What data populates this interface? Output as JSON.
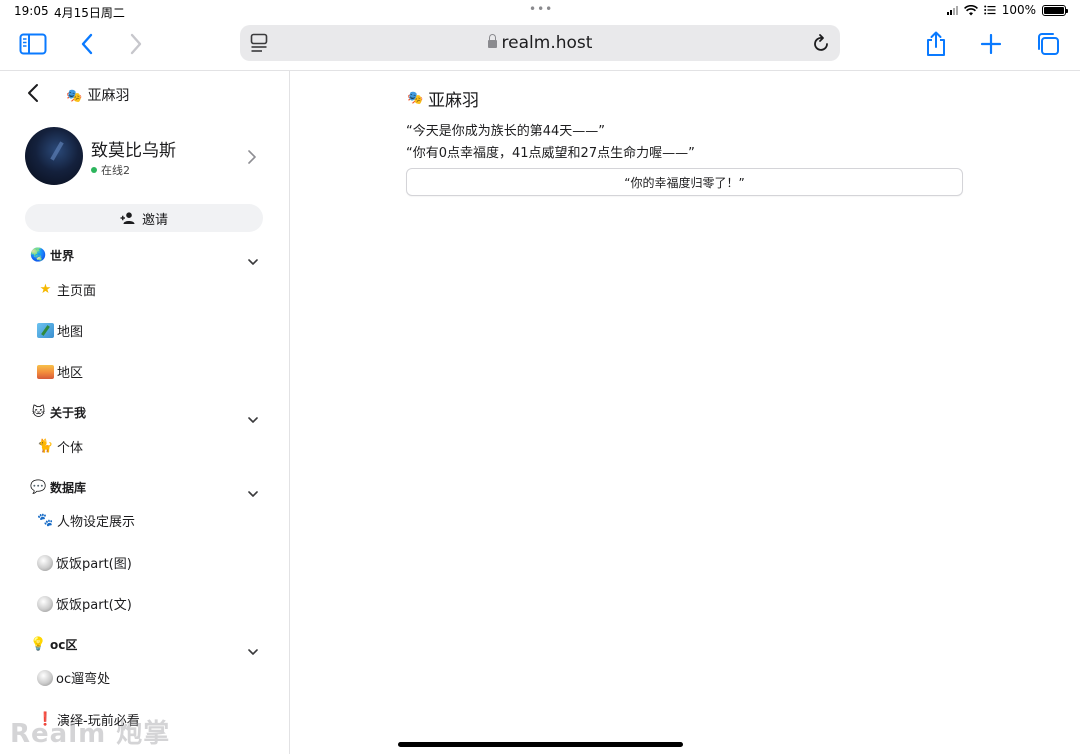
{
  "status_bar": {
    "time": "19:05",
    "date": "4月15日周二",
    "battery": "100%"
  },
  "browser": {
    "url": "realm.host"
  },
  "sidebar": {
    "title": "亚麻羽",
    "user": {
      "name": "致莫比乌斯",
      "status": "在线2"
    },
    "invite_label": "邀请",
    "sections": [
      {
        "label": "世界",
        "icon": "globe-icon",
        "items": [
          {
            "label": "主页面",
            "icon": "star-icon"
          },
          {
            "label": "地图",
            "icon": "map-icon"
          },
          {
            "label": "地区",
            "icon": "sunrise-icon"
          }
        ]
      },
      {
        "label": "关于我",
        "icon": "cat-face-icon",
        "items": [
          {
            "label": "个体",
            "icon": "cat-icon"
          }
        ]
      },
      {
        "label": "数据库",
        "icon": "speech-bubble-icon",
        "items": [
          {
            "label": "人物设定展示",
            "icon": "paw-prints-icon"
          },
          {
            "label": "饭饭part(图)",
            "icon": "sphere-icon"
          },
          {
            "label": "饭饭part(文)",
            "icon": "sphere-icon"
          }
        ]
      },
      {
        "label": "oc区",
        "icon": "lightbulb-icon",
        "items": [
          {
            "label": "oc遛弯处",
            "icon": "sphere-icon"
          },
          {
            "label": "演绎-玩前必看",
            "icon": "exclamation-icon"
          }
        ]
      }
    ],
    "watermark": "Realm 炮掌"
  },
  "main": {
    "title": "亚麻羽",
    "line1": "“今天是你成为族长的第44天——”",
    "line2": "“你有0点幸福度，41点威望和27点生命力喔——”",
    "choice_button": "“你的幸福度归零了！”"
  },
  "colors": {
    "accent": "#0a7aff",
    "online": "#2db55d"
  }
}
